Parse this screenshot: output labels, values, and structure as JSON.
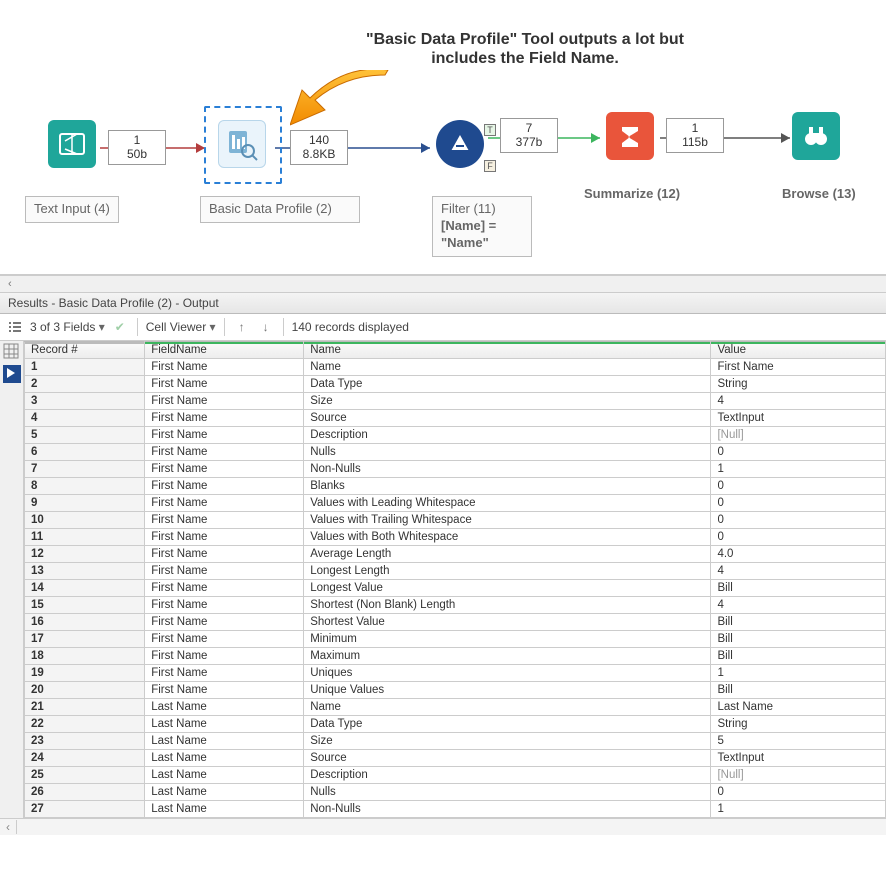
{
  "callout_text": "\"Basic Data Profile\" Tool outputs a lot but includes the Field Name.",
  "tools": {
    "text_input": {
      "label": "Text Input (4)",
      "badge1": "1",
      "badge2": "50b"
    },
    "basic_profile": {
      "label": "Basic Data Profile (2)",
      "badge1": "140",
      "badge2": "8.8KB"
    },
    "filter": {
      "label": "Filter (11)",
      "expr": "[Name] = \"Name\"",
      "badge1": "7",
      "badge2": "377b"
    },
    "summarize": {
      "label": "Summarize (12)",
      "badge1": "1",
      "badge2": "115b"
    },
    "browse": {
      "label": "Browse (13)"
    }
  },
  "results_title": "Results - Basic Data Profile (2) - Output",
  "toolbar": {
    "fields": "3 of 3 Fields",
    "cell_viewer": "Cell Viewer",
    "records": "140 records displayed"
  },
  "columns": [
    "Record #",
    "FieldName",
    "Name",
    "Value"
  ],
  "rows": [
    {
      "n": "1",
      "f": "First Name",
      "name": "Name",
      "v": "First Name"
    },
    {
      "n": "2",
      "f": "First Name",
      "name": "Data Type",
      "v": "String"
    },
    {
      "n": "3",
      "f": "First Name",
      "name": "Size",
      "v": "4"
    },
    {
      "n": "4",
      "f": "First Name",
      "name": "Source",
      "v": "TextInput"
    },
    {
      "n": "5",
      "f": "First Name",
      "name": "Description",
      "v": "[Null]",
      "null": true
    },
    {
      "n": "6",
      "f": "First Name",
      "name": "Nulls",
      "v": "0"
    },
    {
      "n": "7",
      "f": "First Name",
      "name": "Non-Nulls",
      "v": "1"
    },
    {
      "n": "8",
      "f": "First Name",
      "name": "Blanks",
      "v": "0"
    },
    {
      "n": "9",
      "f": "First Name",
      "name": "Values with Leading Whitespace",
      "v": "0"
    },
    {
      "n": "10",
      "f": "First Name",
      "name": "Values with Trailing Whitespace",
      "v": "0"
    },
    {
      "n": "11",
      "f": "First Name",
      "name": "Values with Both Whitespace",
      "v": "0"
    },
    {
      "n": "12",
      "f": "First Name",
      "name": "Average Length",
      "v": "4.0"
    },
    {
      "n": "13",
      "f": "First Name",
      "name": "Longest Length",
      "v": "4"
    },
    {
      "n": "14",
      "f": "First Name",
      "name": "Longest Value",
      "v": "Bill"
    },
    {
      "n": "15",
      "f": "First Name",
      "name": "Shortest (Non Blank) Length",
      "v": "4"
    },
    {
      "n": "16",
      "f": "First Name",
      "name": "Shortest Value",
      "v": "Bill"
    },
    {
      "n": "17",
      "f": "First Name",
      "name": "Minimum",
      "v": "Bill"
    },
    {
      "n": "18",
      "f": "First Name",
      "name": "Maximum",
      "v": "Bill"
    },
    {
      "n": "19",
      "f": "First Name",
      "name": "Uniques",
      "v": "1"
    },
    {
      "n": "20",
      "f": "First Name",
      "name": "Unique Values",
      "v": "Bill"
    },
    {
      "n": "21",
      "f": "Last Name",
      "name": "Name",
      "v": "Last Name"
    },
    {
      "n": "22",
      "f": "Last Name",
      "name": "Data Type",
      "v": "String"
    },
    {
      "n": "23",
      "f": "Last Name",
      "name": "Size",
      "v": "5"
    },
    {
      "n": "24",
      "f": "Last Name",
      "name": "Source",
      "v": "TextInput"
    },
    {
      "n": "25",
      "f": "Last Name",
      "name": "Description",
      "v": "[Null]",
      "null": true
    },
    {
      "n": "26",
      "f": "Last Name",
      "name": "Nulls",
      "v": "0"
    },
    {
      "n": "27",
      "f": "Last Name",
      "name": "Non-Nulls",
      "v": "1"
    }
  ]
}
